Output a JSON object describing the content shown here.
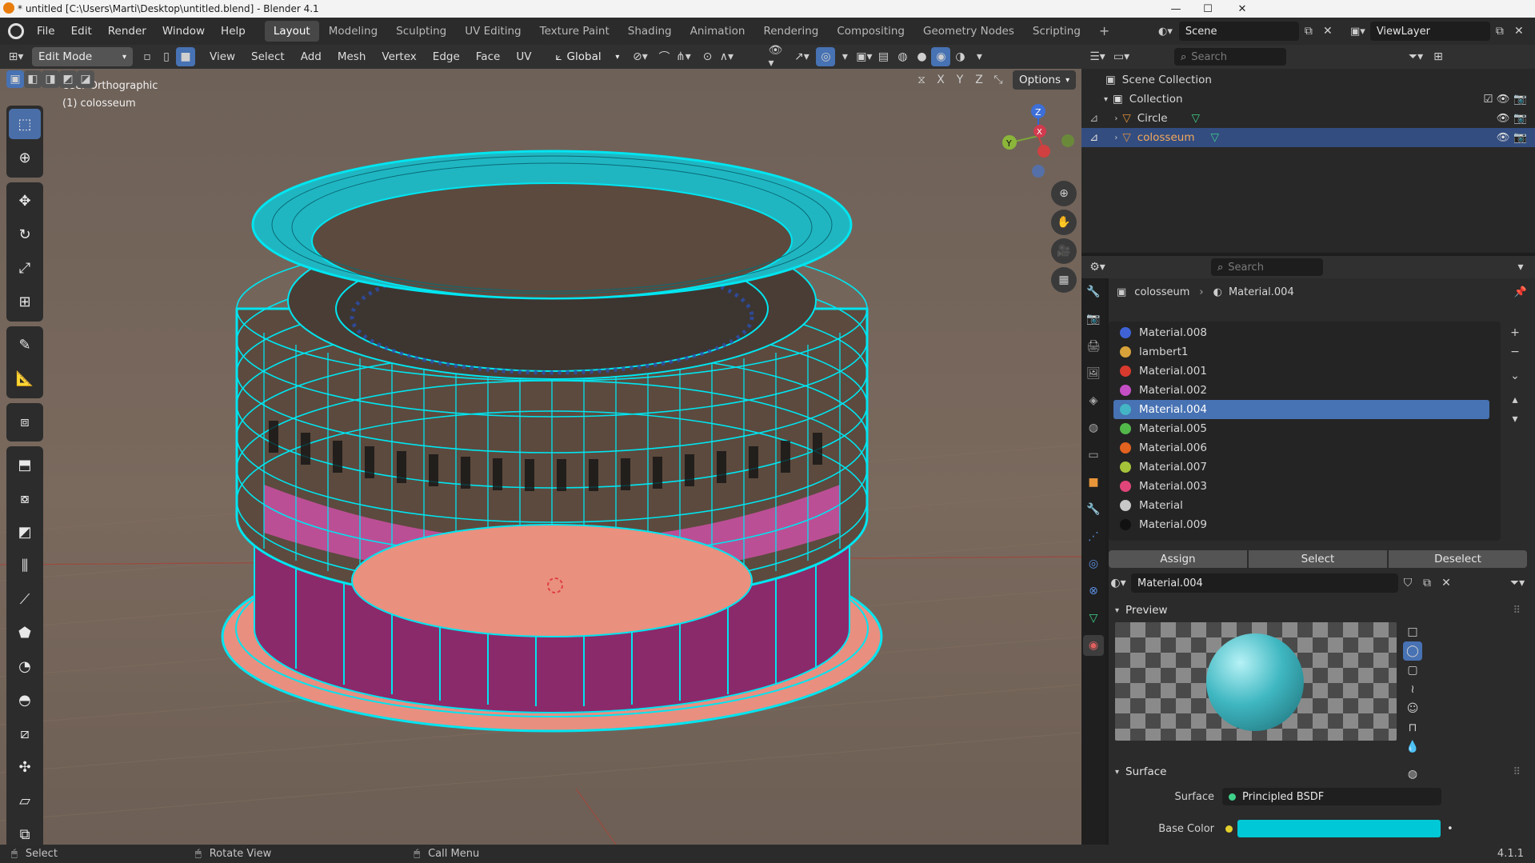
{
  "titlebar": {
    "title": "* untitled [C:\\Users\\Marti\\Desktop\\untitled.blend] - Blender 4.1",
    "minimize": "—",
    "maximize": "☐",
    "close": "✕"
  },
  "menus": [
    "File",
    "Edit",
    "Render",
    "Window",
    "Help"
  ],
  "workspaces": [
    "Layout",
    "Modeling",
    "Sculpting",
    "UV Editing",
    "Texture Paint",
    "Shading",
    "Animation",
    "Rendering",
    "Compositing",
    "Geometry Nodes",
    "Scripting"
  ],
  "active_workspace": "Layout",
  "scene": {
    "name": "Scene",
    "view_layer": "ViewLayer"
  },
  "header": {
    "mode": "Edit Mode",
    "menus": [
      "View",
      "Select",
      "Add",
      "Mesh",
      "Vertex",
      "Edge",
      "Face",
      "UV"
    ],
    "orientation": "Global",
    "options": "Options",
    "axes": [
      "X",
      "Y",
      "Z"
    ]
  },
  "viewport": {
    "view_name": "User Orthographic",
    "object_label": "(1) colosseum",
    "gizmo_axes": {
      "z": "Z",
      "x": "X",
      "y": "Y"
    }
  },
  "outliner": {
    "search_placeholder": "Search",
    "scene_collection": "Scene Collection",
    "collection": "Collection",
    "objects": [
      {
        "name": "Circle",
        "selected": false
      },
      {
        "name": "colosseum",
        "selected": true
      }
    ]
  },
  "properties": {
    "search_placeholder": "Search",
    "breadcrumb_object": "colosseum",
    "breadcrumb_material": "Material.004",
    "materials": [
      {
        "name": "Material.008",
        "color": "#3f63d6"
      },
      {
        "name": "lambert1",
        "color": "#d8a23a"
      },
      {
        "name": "Material.001",
        "color": "#d83a2e"
      },
      {
        "name": "Material.002",
        "color": "#c44fc4"
      },
      {
        "name": "Material.004",
        "color": "#44b5c4",
        "selected": true
      },
      {
        "name": "Material.005",
        "color": "#52b84a"
      },
      {
        "name": "Material.006",
        "color": "#e2621f"
      },
      {
        "name": "Material.007",
        "color": "#a5c43a"
      },
      {
        "name": "Material.003",
        "color": "#e0457a"
      },
      {
        "name": "Material",
        "color": "#c8c8c8"
      },
      {
        "name": "Material.009",
        "color": "#111111"
      }
    ],
    "assign": "Assign",
    "select": "Select",
    "deselect": "Deselect",
    "active_material": "Material.004",
    "preview_label": "Preview",
    "surface_label": "Surface",
    "surface_field_label": "Surface",
    "surface_shader": "Principled BSDF",
    "base_color_label": "Base Color",
    "base_color": "#00c8d6"
  },
  "statusbar": {
    "select": "Select",
    "rotate": "Rotate View",
    "call_menu": "Call Menu",
    "version": "4.1.1"
  },
  "colors": {
    "accent_blue": "#4772b3",
    "mesh_wire": "#00e5f0",
    "selected_face": "#c5509e"
  }
}
